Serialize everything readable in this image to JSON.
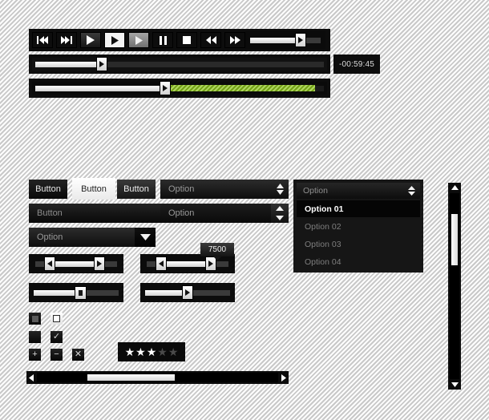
{
  "player": {
    "transport_buttons": [
      {
        "name": "skip-back-button",
        "icon": "skip-back-icon",
        "state": "normal"
      },
      {
        "name": "skip-forward-button",
        "icon": "skip-forward-icon",
        "state": "normal"
      },
      {
        "name": "play-button",
        "icon": "play-icon",
        "state": "normal"
      },
      {
        "name": "play-button-active",
        "icon": "play-icon",
        "state": "active"
      },
      {
        "name": "play-button-disabled",
        "icon": "play-icon",
        "state": "disabled"
      },
      {
        "name": "pause-button",
        "icon": "pause-icon",
        "state": "normal"
      },
      {
        "name": "stop-button",
        "icon": "stop-icon",
        "state": "normal"
      },
      {
        "name": "rewind-button",
        "icon": "rewind-icon",
        "state": "normal"
      },
      {
        "name": "fast-forward-button",
        "icon": "fast-forward-icon",
        "state": "normal"
      }
    ],
    "volume": {
      "value_percent": 72
    },
    "seek": {
      "value_percent": 23
    },
    "time_remaining": "-00:59:45",
    "buffer": {
      "played_percent": 45,
      "buffered_percent": 97,
      "buffer_color": "#8cc41b"
    }
  },
  "buttons": {
    "primary": "Button",
    "light": "Button",
    "mid": "Button",
    "disabled_wide": "Button"
  },
  "selects": {
    "stepper_top": "Option",
    "stepper_bottom": "Option",
    "chevron": "Option"
  },
  "dropdown": {
    "header": "Option",
    "items": [
      {
        "label": "Option 01",
        "selected": true
      },
      {
        "label": "Option 02",
        "selected": false
      },
      {
        "label": "Option 03",
        "selected": false
      },
      {
        "label": "Option 04",
        "selected": false
      }
    ]
  },
  "sliders": {
    "range_left": {
      "low_percent": 18,
      "high_percent": 78
    },
    "range_right": {
      "low_percent": 18,
      "high_percent": 78,
      "tooltip": "7500"
    },
    "single_square": {
      "value_percent": 55
    },
    "single_triangle": {
      "value_percent": 50
    }
  },
  "checkboxes": {
    "row1": [
      {
        "name": "checkbox-indeterminate",
        "glyph": ""
      },
      {
        "name": "checkbox-unchecked-light",
        "glyph": ""
      }
    ],
    "row2": [
      {
        "name": "checkbox-filled",
        "glyph": ""
      },
      {
        "name": "checkbox-checked",
        "glyph": "✓"
      }
    ],
    "row3": [
      {
        "name": "plus-button",
        "glyph": "+"
      },
      {
        "name": "minus-button",
        "glyph": "−"
      },
      {
        "name": "close-button",
        "glyph": "✕"
      }
    ]
  },
  "rating": {
    "filled": 3,
    "total": 5,
    "star_glyph": "★"
  },
  "scrollbars": {
    "horizontal": {
      "thumb_left_percent": 21,
      "thumb_width_percent": 36
    },
    "vertical": {
      "thumb_top_percent": 11,
      "thumb_height_percent": 28
    }
  }
}
